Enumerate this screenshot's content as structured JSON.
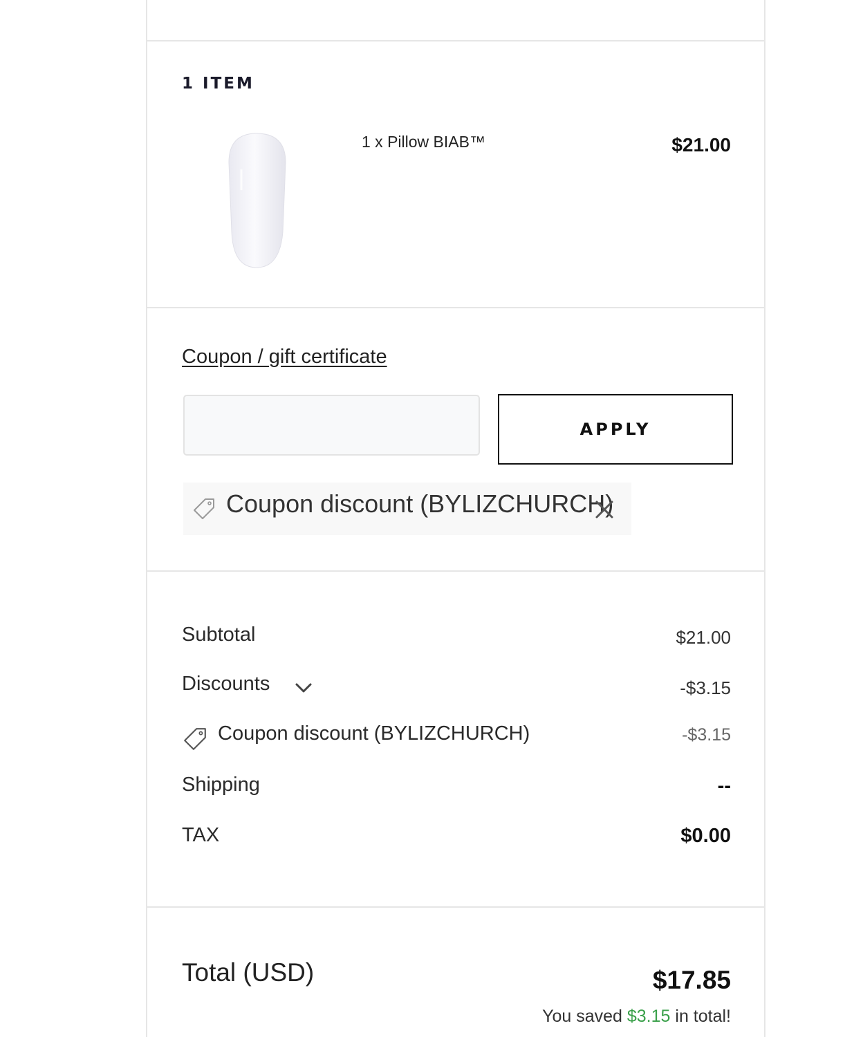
{
  "cart": {
    "items_heading": "1 ITEM",
    "items": [
      {
        "name": "1 x Pillow BIAB™",
        "price": "$21.00",
        "image": "nail-polish-swatch",
        "swatch_color": "#f1f1f6"
      }
    ]
  },
  "coupon": {
    "link_label": "Coupon / gift certificate",
    "input_value": "",
    "input_placeholder": "",
    "apply_label": "APPLY",
    "applied": {
      "label": "Coupon discount (BYLIZCHURCH)",
      "icon": "tag-icon",
      "remove_icon": "close-icon"
    }
  },
  "summary": {
    "subtotal_label": "Subtotal",
    "subtotal_value": "$21.00",
    "discounts_label": "Discounts",
    "discounts_value": "-$3.15",
    "coupon_row_label": "Coupon discount (BYLIZCHURCH)",
    "coupon_row_value": "-$3.15",
    "shipping_label": "Shipping",
    "shipping_value": "--",
    "tax_label": "TAX",
    "tax_value": "$0.00"
  },
  "total": {
    "label": "Total (USD)",
    "value": "$17.85",
    "saved_prefix": "You saved ",
    "saved_amount": "$3.15",
    "saved_suffix": " in total!"
  },
  "colors": {
    "border": "#e6e6e6",
    "savings_green": "#3aa04a"
  }
}
